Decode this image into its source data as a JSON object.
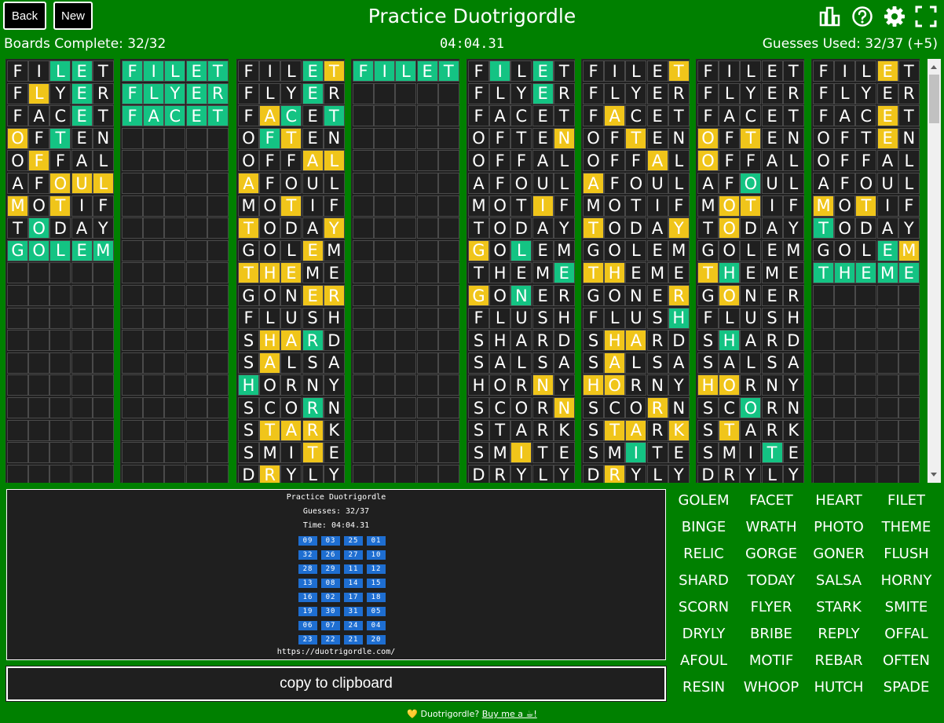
{
  "header": {
    "back_label": "Back",
    "new_label": "New",
    "title": "Practice Duotrigordle",
    "icons": [
      "bar-chart-icon",
      "help-icon",
      "gear-icon",
      "fullscreen-icon"
    ]
  },
  "status": {
    "boards_complete": "Boards Complete: 32/32",
    "timer": "04:04.31",
    "guesses_used": "Guesses Used: 32/37 (+5)"
  },
  "colors": {
    "background": "#008000",
    "correct": "#14c383",
    "present": "#f0c51a",
    "board": "#1f1f1f"
  },
  "guesses": [
    "FILET",
    "FLYER",
    "FACET",
    "OFTEN",
    "OFFAL",
    "AFOUL",
    "MOTIF",
    "TODAY",
    "GOLEM",
    "THEME",
    "GONER",
    "FLUSH",
    "SHARD",
    "SALSA",
    "HORNY",
    "SCORN",
    "STARK",
    "SMITE",
    "DRYLY"
  ],
  "boards": [
    {
      "rows": [
        "ssggs",
        "sysgs",
        "sssgs",
        "ysgss",
        "sysss",
        "ssyyy",
        "ysyss",
        "sgsss",
        "ggggg"
      ]
    },
    {
      "rows": [
        "ggggg",
        "ggggg",
        "ggggg"
      ]
    },
    {
      "rows": [
        "sssgy",
        "sssgs",
        "sygsg",
        "sgyss",
        "sssyy",
        "yssss",
        "ssyss",
        "ysssy",
        "sssys",
        "yyyss",
        "sssyy",
        "sssss",
        "syygs",
        "syss",
        "gssss",
        "sssgs",
        "syyys",
        "sssys",
        "syss"
      ]
    },
    {
      "rows": [
        "ggggg"
      ]
    },
    {
      "rows": [
        "sgsgs",
        "sssgs",
        "sssss",
        "ssssy",
        "sssss",
        "sssss",
        "sssys",
        "sssss",
        "ysgss",
        "ssssg",
        "ysgss",
        "sssss",
        "sssss",
        "sssss",
        "sssys",
        "ssssy",
        "sssss",
        "ssyss",
        "sssss"
      ]
    },
    {
      "rows": [
        "ssssy",
        "sssss",
        "sysss",
        "ssyss",
        "sssys",
        "yssss",
        "sssss",
        "ysssy",
        "sssss",
        "yysss",
        "ssssy",
        "ssssg",
        "syyss",
        "syss",
        "yyss",
        "sssys",
        "syysy",
        "ssgss",
        "sysss"
      ]
    },
    {
      "rows": [
        "sssss",
        "sssss",
        "sssss",
        "ysyss",
        "ysss",
        "ssgss",
        "syyss",
        "syss",
        "ssss",
        "ygsss",
        "sysss",
        "sssss",
        "sgsss",
        "sssss",
        "yysss",
        "ssgss",
        "sysss",
        "sssgs",
        "sssss"
      ]
    },
    {
      "rows": [
        "sssys",
        "sssss",
        "sssys",
        "sssys",
        "sssss",
        "sssss",
        "ysysss",
        "gssss",
        "sssgy",
        "ggggg"
      ]
    }
  ],
  "share": {
    "title": "Practice Duotrigordle",
    "guesses": "Guesses: 32/37",
    "time": "Time: 04:04.31",
    "grid": [
      [
        "09",
        "03",
        "25",
        "01"
      ],
      [
        "32",
        "26",
        "27",
        "10"
      ],
      [
        "28",
        "29",
        "11",
        "12"
      ],
      [
        "13",
        "08",
        "14",
        "15"
      ],
      [
        "16",
        "02",
        "17",
        "18"
      ],
      [
        "19",
        "30",
        "31",
        "05"
      ],
      [
        "06",
        "07",
        "24",
        "04"
      ],
      [
        "23",
        "22",
        "21",
        "20"
      ]
    ],
    "url": "https://duotrigordle.com/"
  },
  "copy_label": "copy to clipboard",
  "words": [
    "GOLEM",
    "FACET",
    "HEART",
    "FILET",
    "BINGE",
    "WRATH",
    "PHOTO",
    "THEME",
    "RELIC",
    "GORGE",
    "GONER",
    "FLUSH",
    "SHARD",
    "TODAY",
    "SALSA",
    "HORNY",
    "SCORN",
    "FLYER",
    "STARK",
    "SMITE",
    "DRYLY",
    "BRIBE",
    "REPLY",
    "OFFAL",
    "AFOUL",
    "MOTIF",
    "REBAR",
    "OFTEN",
    "RESIN",
    "WHOOP",
    "HUTCH",
    "SPADE"
  ],
  "footer": {
    "heart": "💛",
    "text": "Duotrigordle?",
    "link": "Buy me a ☕!"
  }
}
